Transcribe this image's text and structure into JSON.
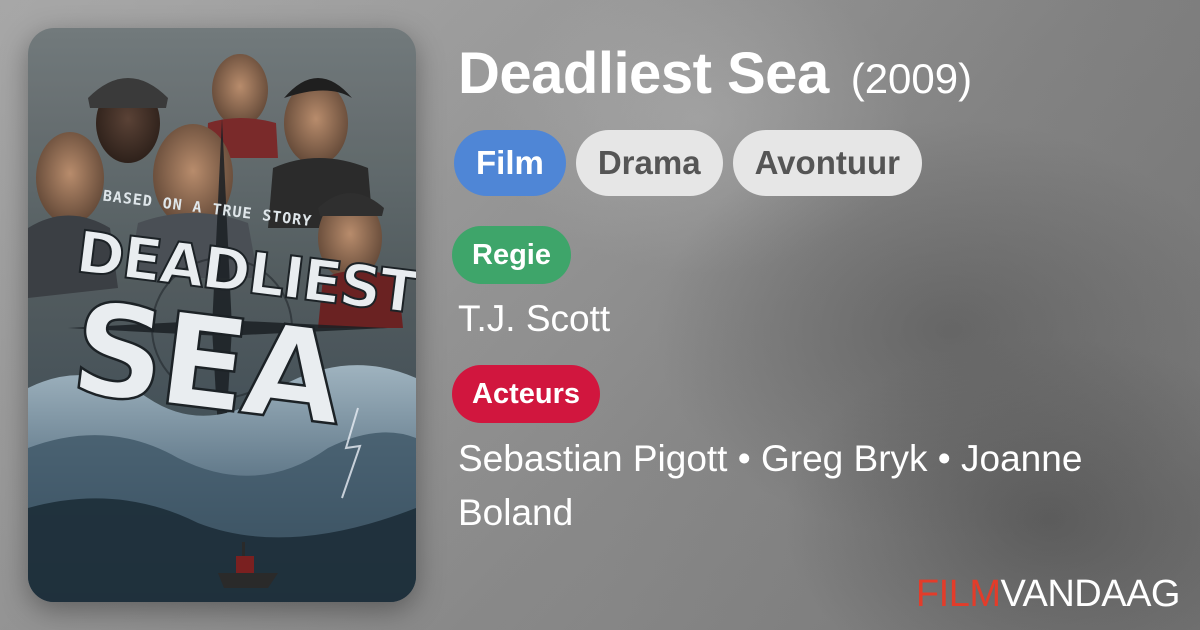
{
  "movie": {
    "title": "Deadliest Sea",
    "year": "(2009)",
    "poster": {
      "tagline": "BASED ON A TRUE STORY",
      "title_line1": "DEADLIEST",
      "title_line2": "SEA"
    }
  },
  "tags": [
    {
      "label": "Film",
      "color": "#4f86d6"
    },
    {
      "label": "Drama",
      "color": "#e6e6e6"
    },
    {
      "label": "Avontuur",
      "color": "#e6e6e6"
    }
  ],
  "director": {
    "label": "Regie",
    "label_color": "#3ea56a",
    "value": "T.J. Scott"
  },
  "cast": {
    "label": "Acteurs",
    "label_color": "#d1163e",
    "value": "Sebastian Pigott • Greg Bryk • Joanne Boland"
  },
  "brand": {
    "part1": "FILM",
    "part2": "VANDAAG",
    "accent_color": "#e33c2a"
  }
}
